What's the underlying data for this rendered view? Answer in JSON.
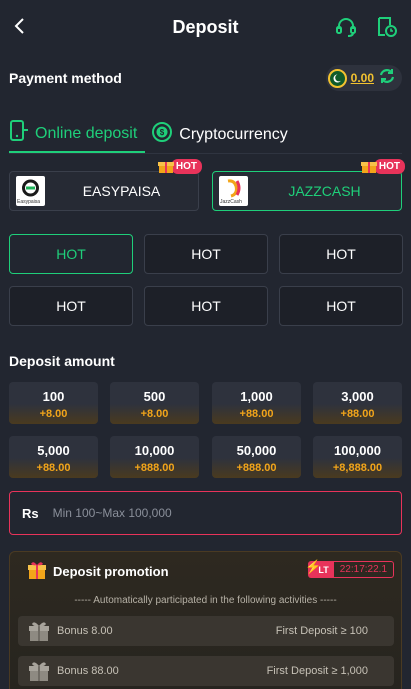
{
  "header": {
    "title": "Deposit",
    "back_icon": "chevron-left-icon",
    "support_icon": "headset-icon",
    "history_icon": "clock-document-icon"
  },
  "payment_method": {
    "label": "Payment method",
    "balance": "0.00",
    "accent": "#1fcf7a"
  },
  "tabs": [
    {
      "label": "Online deposit",
      "active": true
    },
    {
      "label": "Cryptocurrency",
      "active": false
    }
  ],
  "channels": [
    {
      "name": "EASYPAISA",
      "logo_text": "Easypaisa",
      "badge": "HOT",
      "selected": false
    },
    {
      "name": "JAZZCASH",
      "logo_text": "JazzCash",
      "badge": "HOT",
      "selected": true
    }
  ],
  "hot_options": [
    "HOT",
    "HOT",
    "HOT",
    "HOT",
    "HOT",
    "HOT"
  ],
  "deposit_amount": {
    "label": "Deposit amount",
    "options": [
      {
        "amount": "100",
        "bonus": "+8.00"
      },
      {
        "amount": "500",
        "bonus": "+8.00"
      },
      {
        "amount": "1,000",
        "bonus": "+88.00"
      },
      {
        "amount": "3,000",
        "bonus": "+88.00"
      },
      {
        "amount": "5,000",
        "bonus": "+88.00"
      },
      {
        "amount": "10,000",
        "bonus": "+888.00"
      },
      {
        "amount": "50,000",
        "bonus": "+888.00"
      },
      {
        "amount": "100,000",
        "bonus": "+8,888.00"
      }
    ]
  },
  "amount_input": {
    "currency": "Rs",
    "placeholder": "Min 100~Max 100,000"
  },
  "promotion": {
    "title": "Deposit promotion",
    "tag": "LT",
    "timer": "22:17:22.1",
    "subtitle": "----- Automatically participated in the following activities -----",
    "rows": [
      {
        "name": "Bonus 8.00",
        "condition": "First Deposit ≥ 100"
      },
      {
        "name": "Bonus 88.00",
        "condition": "First Deposit ≥ 1,000"
      }
    ]
  }
}
